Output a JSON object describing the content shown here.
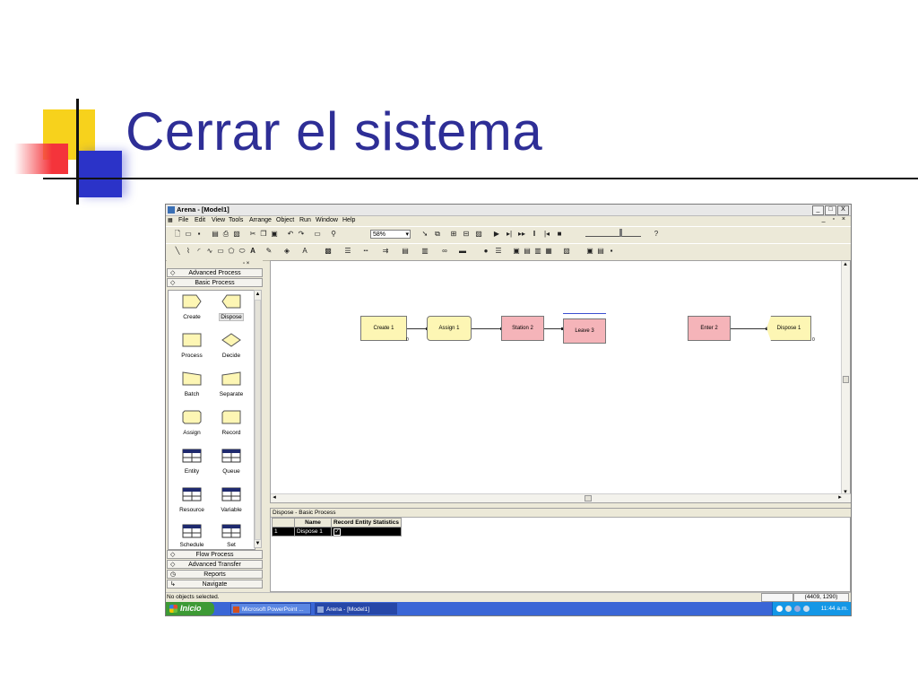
{
  "slide": {
    "title": "Cerrar el sistema"
  },
  "window": {
    "title": "Arena - [Model1]",
    "controls": [
      "_",
      "□",
      "X"
    ]
  },
  "menu": [
    "File",
    "Edit",
    "View",
    "Tools",
    "Arrange",
    "Object",
    "Run",
    "Window",
    "Help"
  ],
  "toolbar": {
    "zoom": "58%"
  },
  "project_bar": {
    "panels": [
      "Advanced Process",
      "Basic Process",
      "Flow Process",
      "Advanced Transfer",
      "Reports",
      "Navigate"
    ],
    "shapes": [
      "Create",
      "Dispose",
      "Process",
      "Decide",
      "Batch",
      "Separate",
      "Assign",
      "Record",
      "Entity",
      "Queue",
      "Resource",
      "Variable",
      "Schedule",
      "Set"
    ]
  },
  "canvas": {
    "modules": [
      "Create 1",
      "Assign 1",
      "Station 2",
      "Leave 3",
      "Enter 2",
      "Dispose 1"
    ],
    "counters": [
      "0",
      "0"
    ]
  },
  "spreadsheet": {
    "title": "Dispose - Basic Process",
    "columns": [
      "Name",
      "Record Entity Statistics"
    ],
    "rows": [
      {
        "num": "1",
        "name": "Dispose 1",
        "record": "✓"
      }
    ]
  },
  "status": {
    "message": "No objects selected.",
    "coords": "(4409, 1290)"
  },
  "taskbar": {
    "start": "Inicio",
    "tasks": [
      "Microsoft PowerPoint ...",
      "Arena - [Model1]"
    ],
    "clock": "11:44 a.m."
  },
  "colors": {
    "title": "#2e2e96",
    "module_yellow": "#fdf6b4",
    "module_pink": "#f5b4b9",
    "taskbar": "#3a66d6"
  }
}
